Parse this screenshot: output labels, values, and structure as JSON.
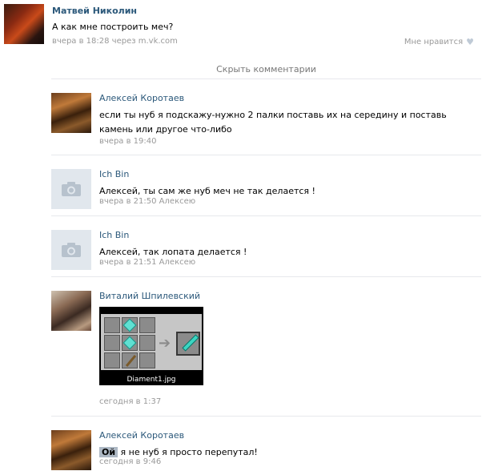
{
  "post": {
    "author": "Матвей Николин",
    "text": "А как мне построить меч?",
    "meta": "вчера в 18:28 через m.vk.com",
    "like_label": "Мне нравится"
  },
  "hide_comments": "Скрыть комментарии",
  "comments": [
    {
      "author": "Алексей Коротаев",
      "text": "если ты нуб я подскажу-нужно 2 палки поставь их на середину и поставь камень или другое что-либо",
      "meta": "вчера в 19:40"
    },
    {
      "author": "Ich Bin",
      "text": "Алексей, ты сам же нуб меч не так делается !",
      "meta": "вчера в 21:50 Алексею"
    },
    {
      "author": "Ich Bin",
      "text": "Алексей, так лопата делается !",
      "meta": "вчера в 21:51 Алексею"
    },
    {
      "author": "Виталий Шпилевский",
      "attachment_name": "Diament1.jpg",
      "meta": "сегодня в 1:37"
    },
    {
      "author": "Алексей Коротаев",
      "highlight": "Ой",
      "text": " я не нуб я просто перепутал!",
      "meta": "сегодня в 9:46"
    }
  ]
}
